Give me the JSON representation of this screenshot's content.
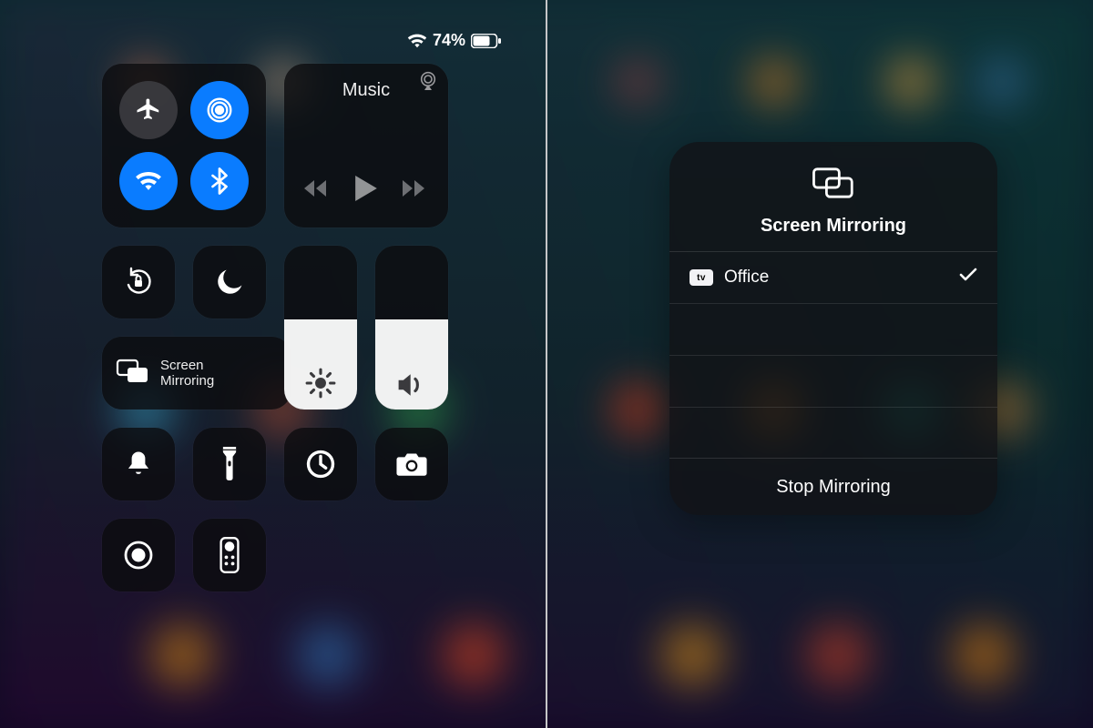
{
  "status": {
    "battery_pct": "74%"
  },
  "cc": {
    "connectivity": {
      "airplane": {
        "icon": "airplane-icon",
        "on": false
      },
      "airdrop": {
        "icon": "airdrop-icon",
        "on": true
      },
      "wifi": {
        "icon": "wifi-icon",
        "on": true
      },
      "bluetooth": {
        "icon": "bluetooth-icon",
        "on": true
      }
    },
    "now_playing": {
      "title": "Music",
      "airplay_icon": "airplay-icon",
      "prev_icon": "skip-back-icon",
      "play_icon": "play-icon",
      "next_icon": "skip-forward-icon"
    },
    "rotation_lock": {
      "icon": "rotation-lock-icon"
    },
    "do_not_disturb": {
      "icon": "moon-icon"
    },
    "screen_mirroring_tile": {
      "icon": "screen-mirroring-icon",
      "label_line1": "Screen",
      "label_line2": "Mirroring"
    },
    "brightness": {
      "icon": "sun-icon",
      "pct": 55
    },
    "volume": {
      "icon": "speaker-icon",
      "pct": 55
    },
    "mute": {
      "icon": "bell-icon"
    },
    "flashlight": {
      "icon": "flashlight-icon"
    },
    "timer": {
      "icon": "timer-icon"
    },
    "camera": {
      "icon": "camera-icon"
    },
    "screen_record": {
      "icon": "record-icon"
    },
    "apple_tv_remote": {
      "icon": "remote-icon"
    }
  },
  "mirroring_popover": {
    "icon": "screen-mirroring-icon",
    "title": "Screen Mirroring",
    "devices": [
      {
        "badge": "tv",
        "name": "Office",
        "selected": true
      }
    ],
    "blank_rows": 3,
    "stop_label": "Stop Mirroring"
  },
  "colors": {
    "accent_blue": "#0a7cff"
  }
}
